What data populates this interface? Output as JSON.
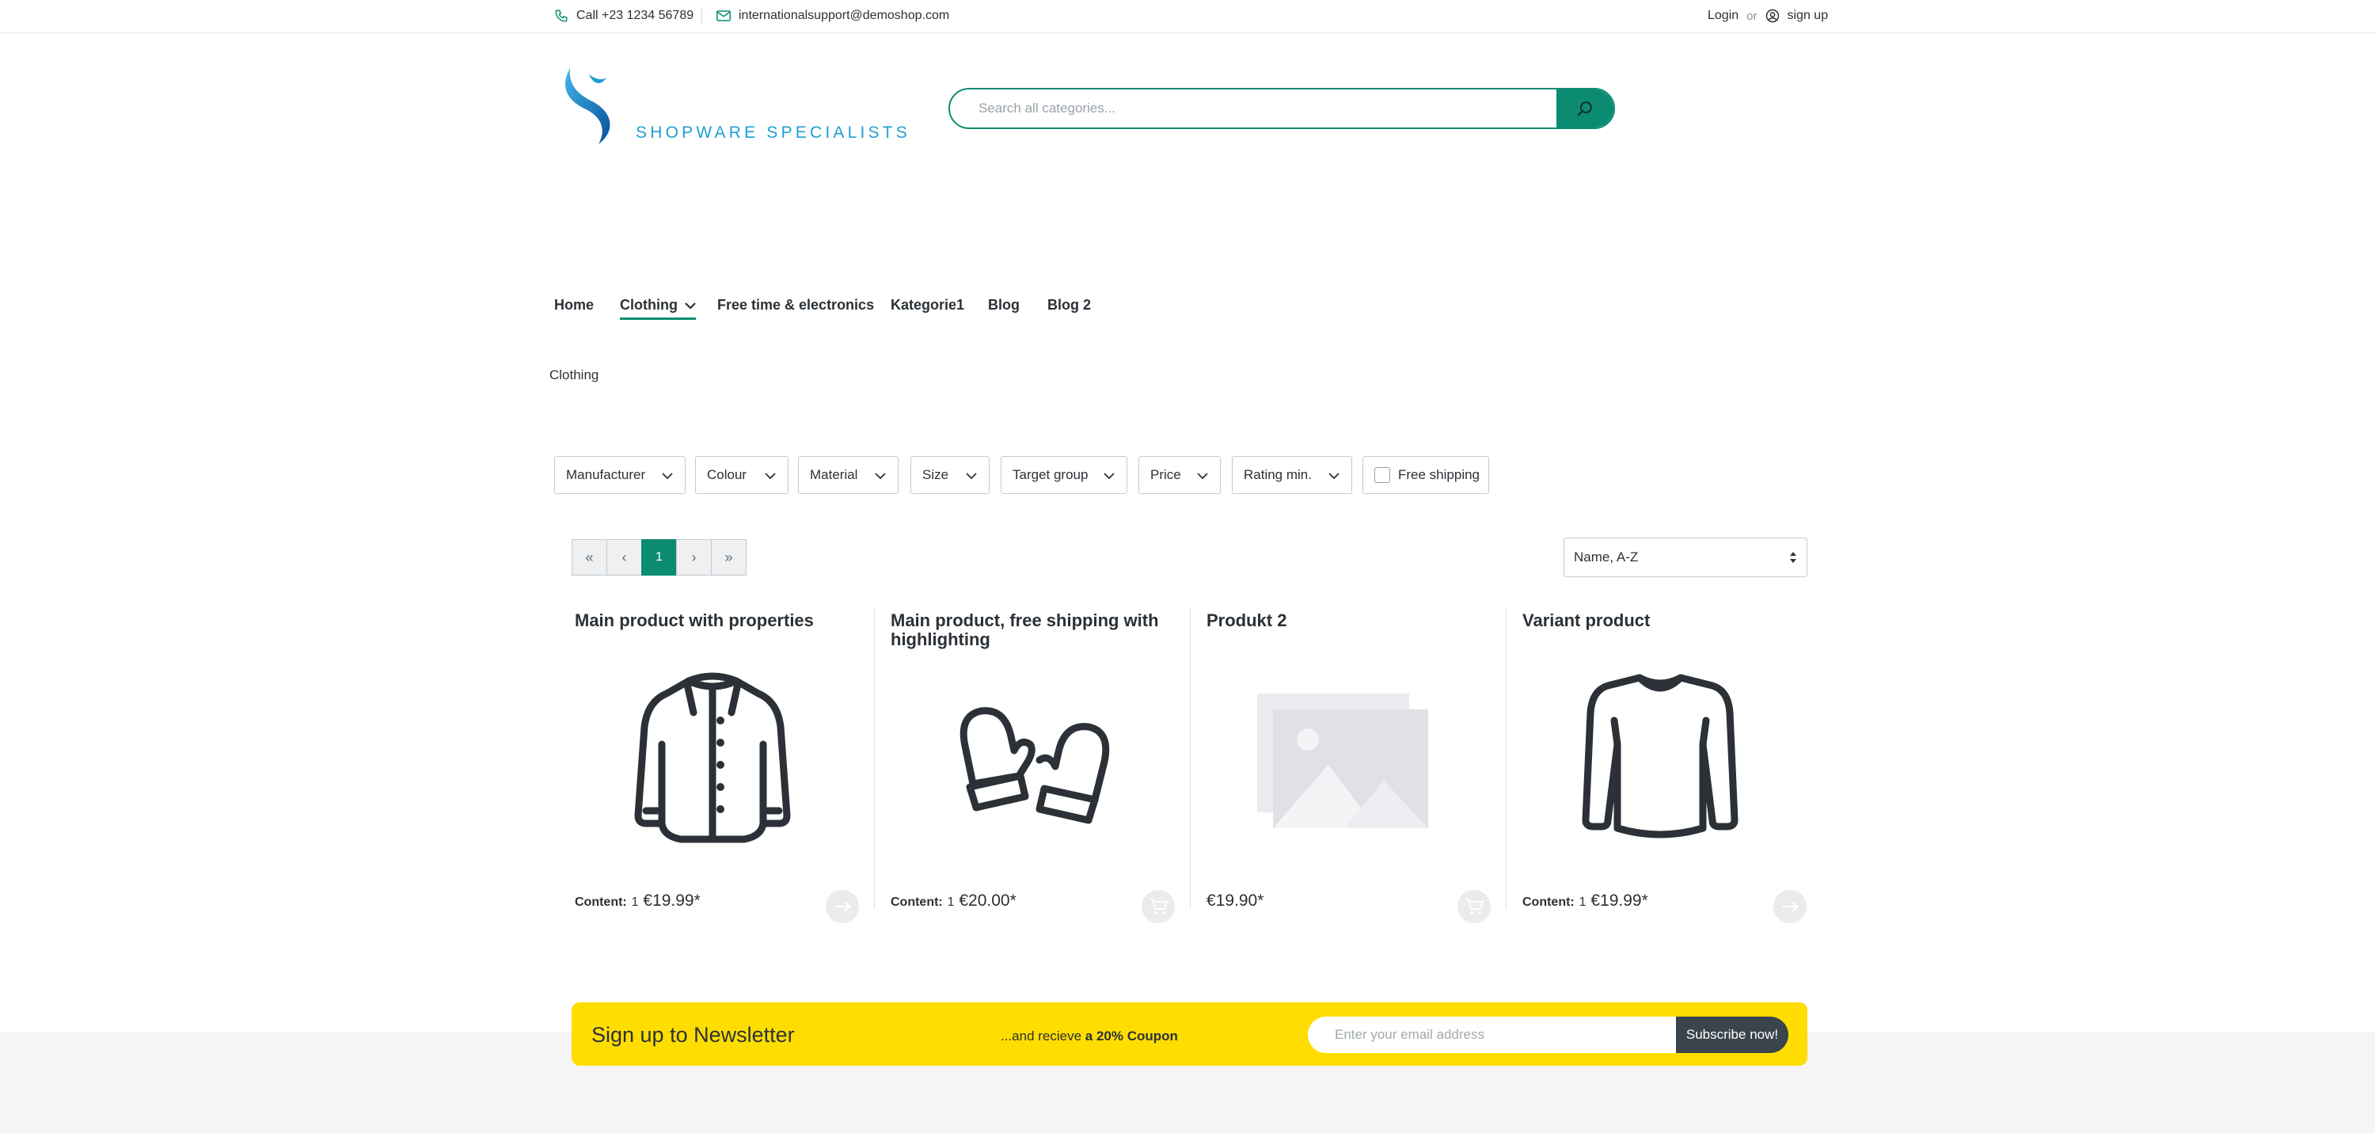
{
  "topbar": {
    "phone": "Call +23 1234 56789",
    "email": "internationalsupport@demoshop.com",
    "login": "Login",
    "or": "or",
    "signup": "sign up"
  },
  "header": {
    "logo_text": "SHOPWARE SPECIALISTS",
    "search_placeholder": "Search all categories..."
  },
  "nav": {
    "items": [
      {
        "label": "Home"
      },
      {
        "label": "Clothing",
        "active": true
      },
      {
        "label": "Free time & electronics"
      },
      {
        "label": "Kategorie1"
      },
      {
        "label": "Blog"
      },
      {
        "label": "Blog 2"
      }
    ]
  },
  "breadcrumb": "Clothing",
  "filters": [
    "Manufacturer",
    "Colour",
    "Material",
    "Size",
    "Target group",
    "Price",
    "Rating min."
  ],
  "free_shipping_label": "Free shipping",
  "pagination": {
    "current": "1",
    "first": "«",
    "prev": "‹",
    "next": "›",
    "last": "»"
  },
  "sort": {
    "selected": "Name, A-Z"
  },
  "products": [
    {
      "title": "Main product with properties",
      "content_label": "Content:",
      "content_value": "1",
      "price": "€19.99*",
      "icon": "jacket-icon",
      "button": "arrow-right-icon"
    },
    {
      "title": "Main product, free shipping with highlighting",
      "content_label": "Content:",
      "content_value": "1",
      "price": "€20.00*",
      "icon": "mittens-icon",
      "button": "cart-icon"
    },
    {
      "title": "Produkt 2",
      "content_label": "",
      "content_value": "",
      "price": "€19.90*",
      "icon": "placeholder-image-icon",
      "button": "cart-icon"
    },
    {
      "title": "Variant product",
      "content_label": "Content:",
      "content_value": "1",
      "price": "€19.99*",
      "icon": "sweater-icon",
      "button": "arrow-right-icon"
    }
  ],
  "newsletter": {
    "title": "Sign up to Newsletter",
    "coupon_prefix": "...and recieve",
    "coupon_bold": "a 20% Coupon",
    "input_placeholder": "Enter your email address",
    "button": "Subscribe now!"
  },
  "colors": {
    "accent": "#0b8c72",
    "logo": "#1f9fd1",
    "newsletter_bg": "#ffdd00",
    "button_dark": "#3a444c"
  }
}
